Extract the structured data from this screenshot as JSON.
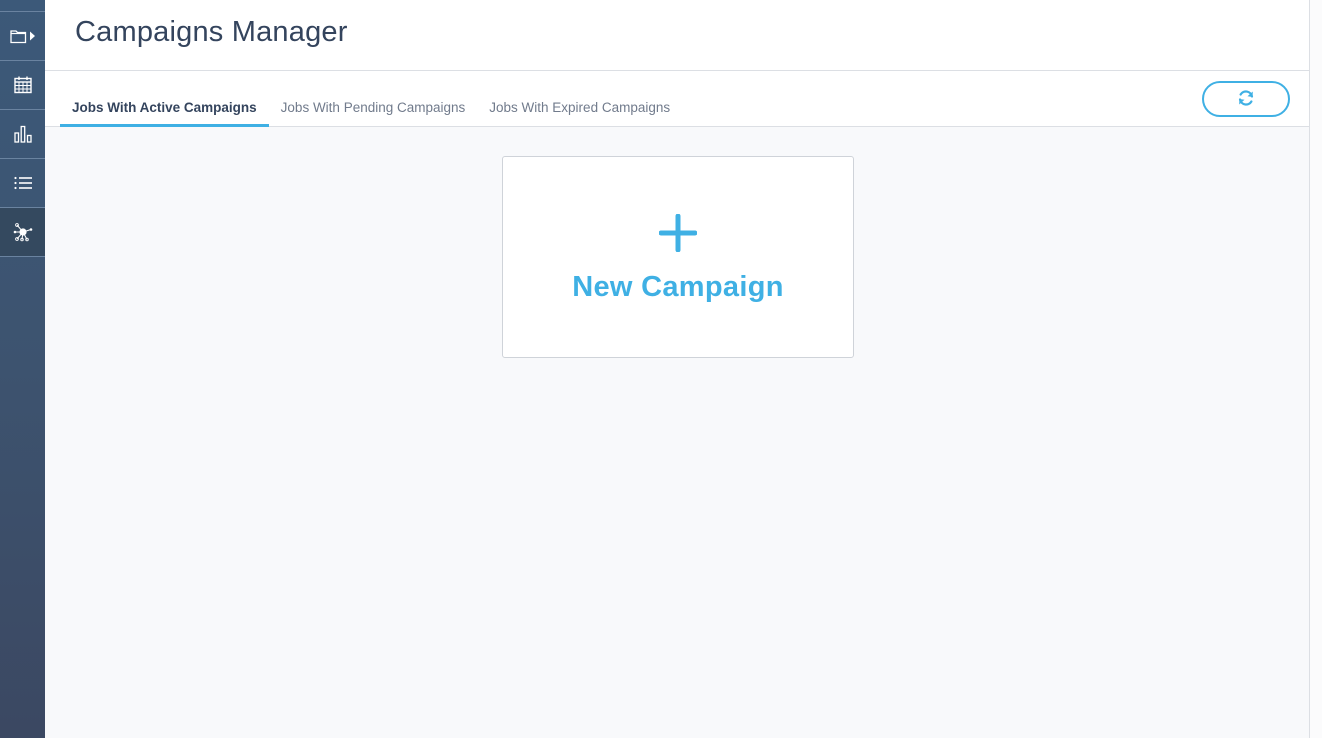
{
  "sidebar": {
    "items": [
      {
        "icon": "folder-play-icon",
        "label": "Jobs"
      },
      {
        "icon": "calendar-icon",
        "label": "Calendar"
      },
      {
        "icon": "bar-chart-icon",
        "label": "Reports"
      },
      {
        "icon": "list-icon",
        "label": "List"
      },
      {
        "icon": "network-hub-icon",
        "label": "Campaigns",
        "active": true
      }
    ]
  },
  "header": {
    "title": "Campaigns Manager"
  },
  "tabs": [
    {
      "label": "Jobs With Active Campaigns",
      "active": true
    },
    {
      "label": "Jobs With Pending Campaigns",
      "active": false
    },
    {
      "label": "Jobs With Expired Campaigns",
      "active": false
    }
  ],
  "toolbar": {
    "refresh_icon": "refresh-icon"
  },
  "new_campaign": {
    "label": "New Campaign",
    "icon": "plus-icon"
  },
  "colors": {
    "accent": "#3fb0e4",
    "title_text": "#34445d",
    "sidebar_bg": "#3c5979"
  }
}
